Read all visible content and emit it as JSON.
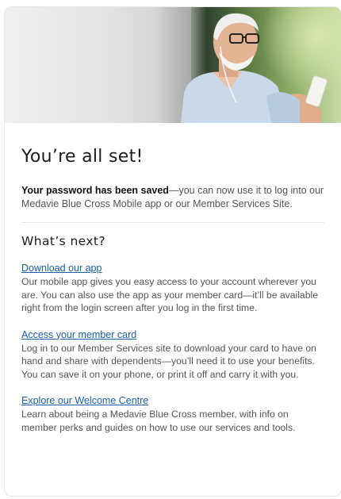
{
  "hero": {
    "image_alt": "Smiling older man wearing glasses and earbuds, looking at a smartphone"
  },
  "title": "You’re all set!",
  "intro": {
    "bold": "Your password has been saved",
    "rest": "—you can now use it to log into our Medavie Blue Cross Mobile app or our Member Services Site."
  },
  "next": {
    "heading": "What’s next?",
    "items": [
      {
        "link": "Download our app",
        "text": "Our mobile app gives you easy access to your account wherever you are. You can also use the app as your member card—it’ll be available right from the login screen after you log in the first time."
      },
      {
        "link": "Access your member card",
        "text": "Log in to our Member Services site to download your card to have on hand and share with dependents—you’ll need it to use your benefits. You can save it on your phone, or print it off and carry it with you."
      },
      {
        "link": "Explore our Welcome Centre",
        "text": "Learn about being a Medavie Blue Cross member, with info on member perks and guides on how to use our services and tools."
      }
    ]
  },
  "colors": {
    "link": "#1a5fa8",
    "body_text": "#555555",
    "heading": "#1d1d1d"
  }
}
